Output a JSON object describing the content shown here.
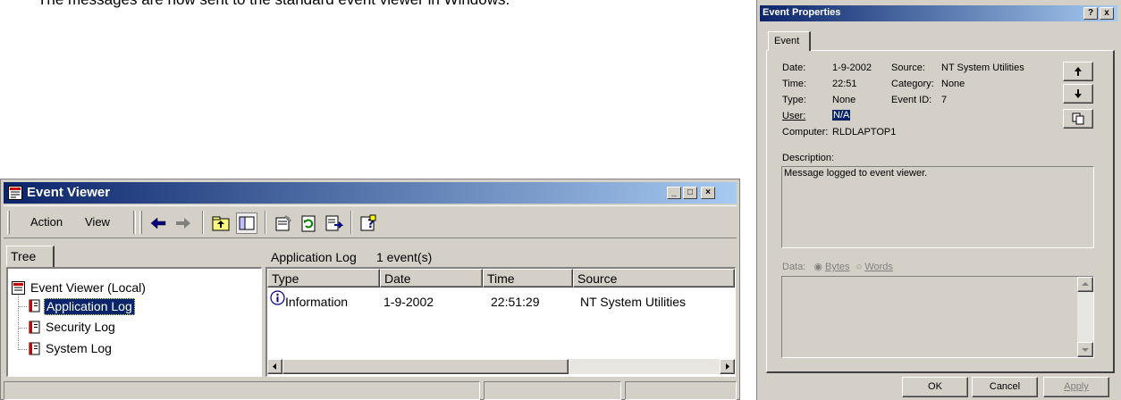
{
  "background_text": "The messages are now sent to the standard event viewer in Windows.",
  "event_viewer": {
    "title": "Event Viewer",
    "menu": [
      "Action",
      "View"
    ],
    "tree_tab": "Tree",
    "tree": {
      "root": "Event Viewer (Local)",
      "items": [
        "Application Log",
        "Security Log",
        "System Log"
      ],
      "selected": "Application Log"
    },
    "list_title": "Application Log",
    "list_count": "1 event(s)",
    "columns": [
      "Type",
      "Date",
      "Time",
      "Source"
    ],
    "rows": [
      {
        "type": "Information",
        "date": "1-9-2002",
        "time": "22:51:29",
        "source": "NT System Utilities"
      }
    ]
  },
  "properties": {
    "title": "Event Properties",
    "help": "?",
    "close": "x",
    "tab": "Event",
    "labels": {
      "date": "Date:",
      "time": "Time:",
      "type": "Type:",
      "user": "User:",
      "computer": "Computer:",
      "source": "Source:",
      "category": "Category:",
      "event_id": "Event ID:",
      "description": "Description:",
      "data": "Data:",
      "bytes": "Bytes",
      "words": "Words"
    },
    "values": {
      "date": "1-9-2002",
      "time": "22:51",
      "type": "None",
      "user": "N/A",
      "computer": "RLDLAPTOP1",
      "source": "NT System Utilities",
      "category": "None",
      "event_id": "7"
    },
    "description_text": "Message logged to event viewer.",
    "buttons": {
      "ok": "OK",
      "cancel": "Cancel",
      "apply": "Apply"
    },
    "colors": {
      "selection": "#0a246a",
      "face": "#d4d0c8"
    }
  }
}
